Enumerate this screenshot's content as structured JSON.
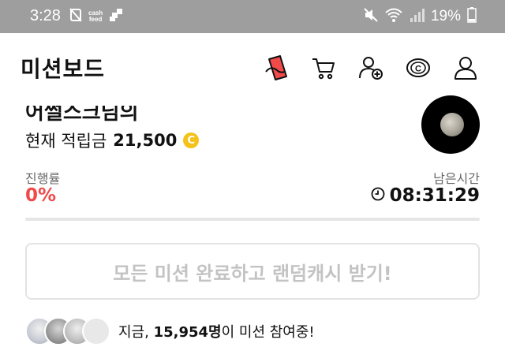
{
  "status_bar": {
    "time": "3:28",
    "cashfeed_top": "cash",
    "cashfeed_bottom": "feed",
    "battery": "19%",
    "icons": [
      "no-disturb-icon",
      "cashfeed-icon",
      "app-icon",
      "mute-icon",
      "wifi-icon",
      "signal-icon",
      "battery-icon"
    ]
  },
  "app_bar": {
    "title": "미션보드",
    "icons": [
      "coupon-icon",
      "cart-icon",
      "add-friend-icon",
      "coin-icon",
      "profile-icon"
    ]
  },
  "user": {
    "greeting": "어썰스크님의",
    "balance_label": "현재 적립금",
    "balance_amount": "21,500",
    "coin_symbol": "C"
  },
  "mission": {
    "progress_label": "진행률",
    "progress_value": "0%",
    "remaining_label": "남은시간",
    "remaining_time": "08:31:29",
    "complete_button": "모든 미션 완료하고 랜덤캐시 받기!"
  },
  "participants": {
    "prefix": "지금, ",
    "count": "15,954명",
    "suffix": "이 미션 참여중!"
  },
  "colors": {
    "status_bar": "#9e9e9e",
    "progress": "#f04a4a",
    "coin": "#f4c218",
    "button_text": "#c3c3c3"
  }
}
